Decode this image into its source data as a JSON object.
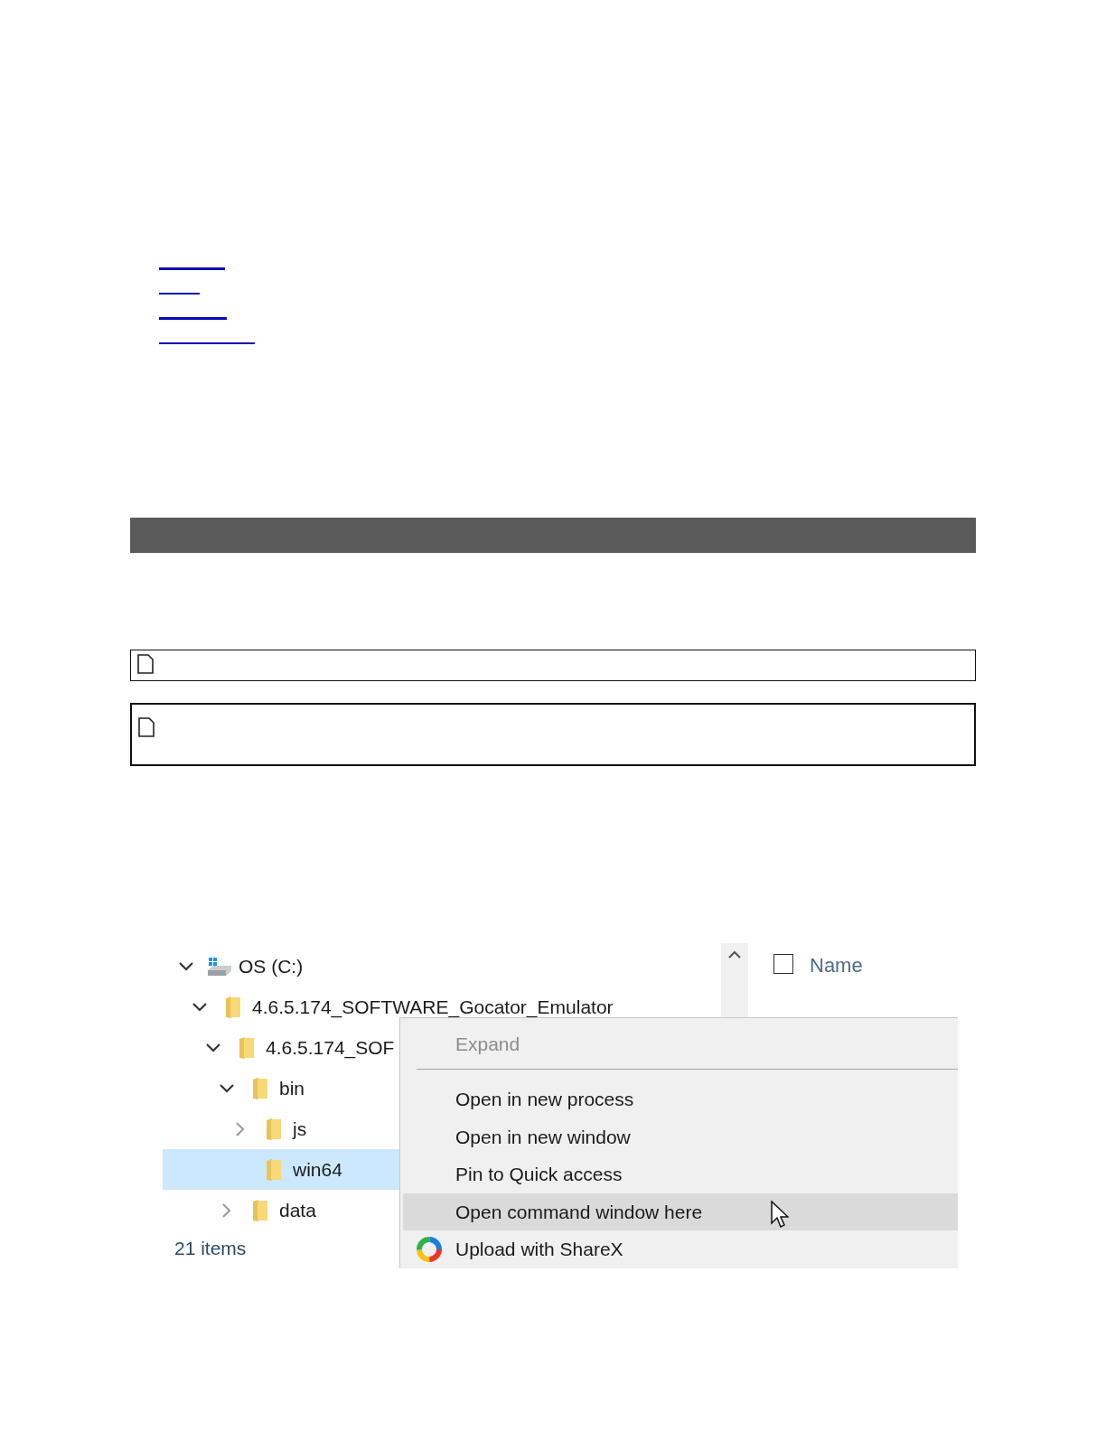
{
  "tree": [
    {
      "label": "OS (C:)",
      "kind": "drive",
      "expanded": true,
      "selected": false,
      "children": [
        {
          "label": "4.6.5.174_SOFTWARE_Gocator_Emulator",
          "kind": "folder",
          "expanded": true,
          "selected": false,
          "children": [
            {
              "label": "4.6.5.174_SOF",
              "kind": "folder",
              "expanded": true,
              "selected": false,
              "children": [
                {
                  "label": "bin",
                  "kind": "folder",
                  "expanded": true,
                  "selected": false,
                  "children": [
                    {
                      "label": "js",
                      "kind": "folder",
                      "expanded": false,
                      "selected": false
                    },
                    {
                      "label": "win64",
                      "kind": "folder",
                      "selected": true
                    }
                  ]
                },
                {
                  "label": "data",
                  "kind": "folder",
                  "expanded": false,
                  "selected": false
                }
              ]
            }
          ]
        }
      ]
    }
  ],
  "status_bar": "21 items",
  "file_list": {
    "select_all": {
      "checked": false
    },
    "columns": [
      "Name"
    ]
  },
  "context_menu": [
    {
      "kind": "item",
      "label": "Expand",
      "disabled": true,
      "highlighted": false
    },
    {
      "kind": "separator"
    },
    {
      "kind": "item",
      "label": "Open in new process",
      "disabled": false,
      "highlighted": false
    },
    {
      "kind": "item",
      "label": "Open in new window",
      "disabled": false,
      "highlighted": false
    },
    {
      "kind": "item",
      "label": "Pin to Quick access",
      "disabled": false,
      "highlighted": false
    },
    {
      "kind": "item",
      "label": "Open command window here",
      "disabled": false,
      "highlighted": true
    },
    {
      "kind": "app_item",
      "label": "Upload with ShareX",
      "disabled": false,
      "highlighted": false
    }
  ]
}
